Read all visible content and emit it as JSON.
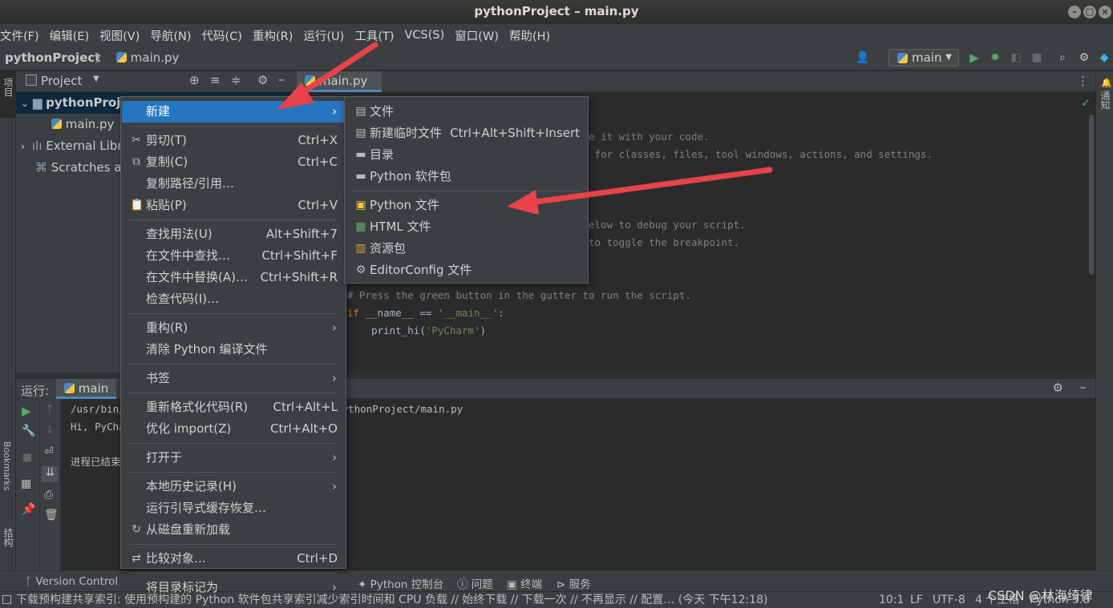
{
  "window": {
    "title": "pythonProject – main.py"
  },
  "menubar": [
    "文件(F)",
    "编辑(E)",
    "视图(V)",
    "导航(N)",
    "代码(C)",
    "重构(R)",
    "运行(U)",
    "工具(T)",
    "VCS(S)",
    "窗口(W)",
    "帮助(H)"
  ],
  "navbar": {
    "project": "pythonProject",
    "separator": "〉",
    "file": "main.py",
    "run_config": "main"
  },
  "left_stripe": {
    "project_label": "项目",
    "bookmarks_label": "Bookmarks",
    "structure_label": "结构"
  },
  "right_stripe": {
    "notifications_label": "通知"
  },
  "project_panel": {
    "title": "Project",
    "tree": [
      {
        "label": "pythonProject",
        "expand": "⌄"
      },
      {
        "label": "main.py"
      },
      {
        "label": "External Libraries",
        "expand": "›"
      },
      {
        "label": "Scratches and Consoles"
      }
    ]
  },
  "editor": {
    "tab": "main.py",
    "lines": [
      {
        "text": "                                    place it with your code."
      },
      {
        "text": "                                    here for classes, files, tool windows, actions, and settings."
      },
      {
        "text": ""
      },
      {
        "text": ""
      },
      {
        "text": ""
      },
      {
        "text": "                                    he below to debug your script."
      },
      {
        "text": "                                    +F8 to toggle the breakpoint."
      },
      {
        "text": ""
      },
      {
        "text": ""
      },
      {
        "text": "# Press the green button in the gutter to run the script."
      },
      {
        "text": "if __name__ == '__main__':"
      },
      {
        "text": "    print_hi('PyCharm')"
      }
    ]
  },
  "run_panel": {
    "label": "运行:",
    "tab": "main",
    "output": [
      "/usr/bin/python3 /home/user/PycharmProjects/pythonProject/main.py",
      "Hi, PyCharm",
      "",
      "进程已结束，退出代码0"
    ]
  },
  "context_menu": {
    "items": [
      {
        "label": "新建",
        "arrow": "›",
        "selected": true
      },
      {
        "sep": true
      },
      {
        "label": "剪切(T)",
        "shortcut": "Ctrl+X",
        "icon": "✂"
      },
      {
        "label": "复制(C)",
        "shortcut": "Ctrl+C",
        "icon": "⧉"
      },
      {
        "label": "复制路径/引用…"
      },
      {
        "label": "粘贴(P)",
        "shortcut": "Ctrl+V",
        "icon": "📋"
      },
      {
        "sep": true
      },
      {
        "label": "查找用法(U)",
        "shortcut": "Alt+Shift+7"
      },
      {
        "label": "在文件中查找…",
        "shortcut": "Ctrl+Shift+F"
      },
      {
        "label": "在文件中替换(A)…",
        "shortcut": "Ctrl+Shift+R"
      },
      {
        "label": "检查代码(I)…"
      },
      {
        "sep": true
      },
      {
        "label": "重构(R)",
        "arrow": "›"
      },
      {
        "label": "清除 Python 编译文件"
      },
      {
        "sep": true
      },
      {
        "label": "书签",
        "arrow": "›"
      },
      {
        "sep": true
      },
      {
        "label": "重新格式化代码(R)",
        "shortcut": "Ctrl+Alt+L"
      },
      {
        "label": "优化 import(Z)",
        "shortcut": "Ctrl+Alt+O"
      },
      {
        "sep": true
      },
      {
        "label": "打开于",
        "arrow": "›"
      },
      {
        "sep": true
      },
      {
        "label": "本地历史记录(H)",
        "arrow": "›"
      },
      {
        "label": "运行引导式缓存恢复…"
      },
      {
        "label": "从磁盘重新加载",
        "icon": "↻"
      },
      {
        "sep": true
      },
      {
        "label": "比较对象…",
        "shortcut": "Ctrl+D",
        "icon": "⇄"
      },
      {
        "sep": true
      },
      {
        "label": "将目录标记为",
        "arrow": "›"
      }
    ]
  },
  "sub_menu": {
    "items": [
      {
        "label": "文件",
        "icon": "▤"
      },
      {
        "label": "新建临时文件",
        "shortcut": "Ctrl+Alt+Shift+Insert",
        "icon": "▤"
      },
      {
        "label": "目录",
        "icon": "▬"
      },
      {
        "label": "Python 软件包",
        "icon": "▬"
      },
      {
        "sep": true
      },
      {
        "label": "Python 文件",
        "icon": "▣"
      },
      {
        "label": "HTML 文件",
        "icon": "▦"
      },
      {
        "label": "资源包",
        "icon": "▥"
      },
      {
        "label": "EditorConfig 文件",
        "icon": "⚙"
      }
    ]
  },
  "tool_tabs": {
    "vcs": "Version Control",
    "python_console": "Python 控制台",
    "problems": "问题",
    "terminal": "终端",
    "services": "服务"
  },
  "statusbar": {
    "message": "下载预构建共享索引: 使用预构建的 Python 软件包共享索引减少索引时间和 CPU 负载 // 始终下载 // 下载一次 // 不再显示 // 配置… (今天 下午12:18)",
    "position": "10:1",
    "line_sep": "LF",
    "encoding": "UTF-8",
    "indent": "4 个空格",
    "interpreter": "Python 3.8"
  },
  "watermark": "CSDN @林海绮律",
  "colors": {
    "accent": "#2675bf",
    "run_green": "#59a869",
    "arrow_red": "#e8434a"
  }
}
